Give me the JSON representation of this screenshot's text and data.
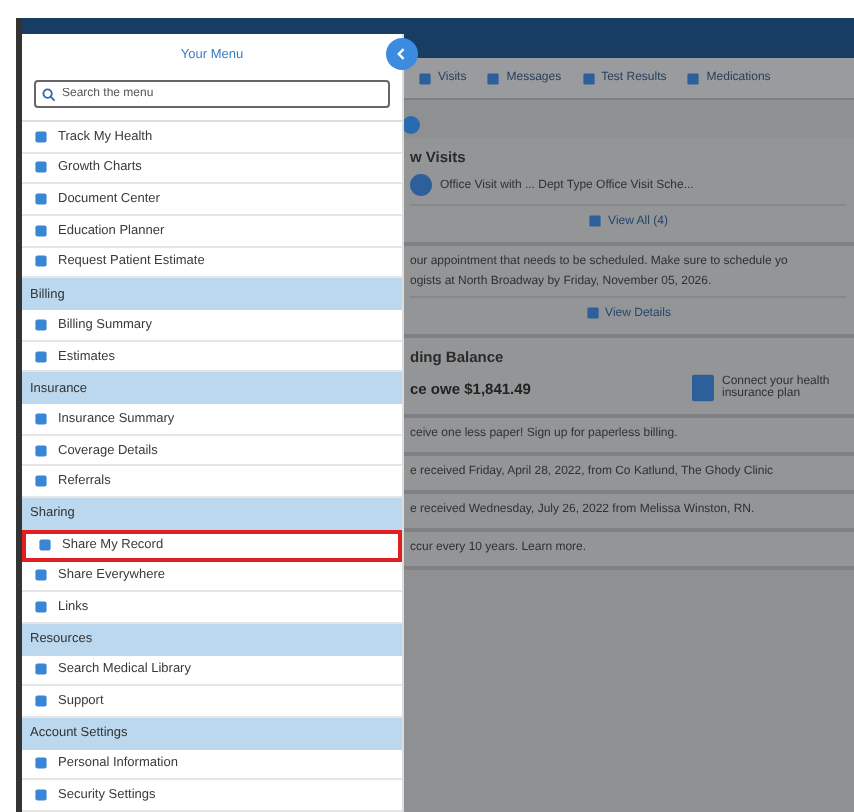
{
  "toolbar": {
    "tabs": [
      {
        "label": "Visits"
      },
      {
        "label": "Messages"
      },
      {
        "label": "Test Results"
      },
      {
        "label": "Medications"
      }
    ]
  },
  "cards": [
    {
      "kind": "visit",
      "heading": "w Visits",
      "lines": [
        "Office Visit with ... Dept Type Office Visit Sche..."
      ],
      "button": "View All (4)"
    },
    {
      "kind": "notice",
      "lines": [
        "our appointment that needs to be scheduled. Make sure to schedule yo",
        "ogists at North Broadway by Friday, November 05, 2026."
      ],
      "button": "View Details"
    },
    {
      "kind": "balance",
      "heading": "ding Balance",
      "amount": "ce owe $1,841.49",
      "side": "Connect your health insurance plan"
    },
    {
      "kind": "text",
      "lines": [
        "ceive one less paper! Sign up for paperless billing."
      ]
    },
    {
      "kind": "text",
      "lines": [
        "e received Friday, April 28, 2022, from Co Katlund, The Ghody Clinic"
      ]
    },
    {
      "kind": "text",
      "lines": [
        "e received Wednesday, July 26, 2022 from Melissa Winston, RN."
      ]
    },
    {
      "kind": "text",
      "lines": [
        "ccur every 10 years. Learn more."
      ]
    }
  ],
  "menu": {
    "title": "Your Menu",
    "search_placeholder": "Search the menu",
    "sections": [
      {
        "items": [
          {
            "label": "Track My Health",
            "selected": false
          },
          {
            "label": "Growth Charts",
            "selected": false
          },
          {
            "label": "Document Center",
            "selected": false
          },
          {
            "label": "Education Planner",
            "selected": false
          },
          {
            "label": "Request Patient Estimate",
            "selected": false
          }
        ]
      },
      {
        "heading": "Billing",
        "items": [
          {
            "label": "Billing Summary",
            "selected": false
          },
          {
            "label": "Estimates",
            "selected": false
          }
        ]
      },
      {
        "heading": "Insurance",
        "items": [
          {
            "label": "Insurance Summary",
            "selected": false
          },
          {
            "label": "Coverage Details",
            "selected": false
          },
          {
            "label": "Referrals",
            "selected": false
          }
        ]
      },
      {
        "heading": "Sharing",
        "items": [
          {
            "label": "Share My Record",
            "selected": true
          },
          {
            "label": "Share Everywhere",
            "selected": false
          },
          {
            "label": "Links",
            "selected": false
          }
        ]
      },
      {
        "heading": "Resources",
        "items": [
          {
            "label": "Search Medical Library",
            "selected": false
          },
          {
            "label": "Support",
            "selected": false
          }
        ]
      },
      {
        "heading": "Account Settings",
        "items": [
          {
            "label": "Personal Information",
            "selected": false
          },
          {
            "label": "Security Settings",
            "selected": false
          }
        ]
      }
    ]
  }
}
